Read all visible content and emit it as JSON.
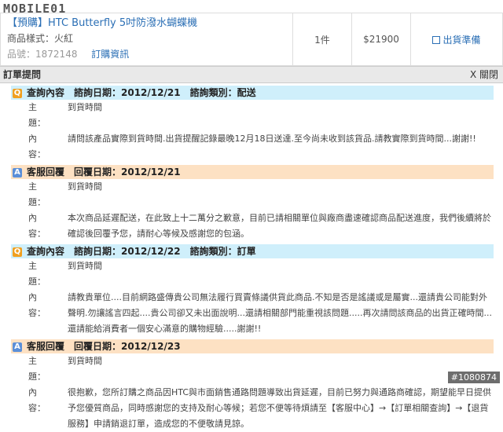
{
  "logo": "MOBILE01",
  "order": {
    "product_name": "【預購】HTC Butterfly 5吋防潑水蝴蝶機",
    "style_label": "商品樣式：",
    "style_value": "火紅",
    "sku_label": "品號：",
    "sku_value": "1872148",
    "inquiry_link": "訂購資訊",
    "quantity": "1件",
    "price": "$21900",
    "ship_status": "出貨準備"
  },
  "panel": {
    "title": "訂單提問",
    "close_label": "X 關閉"
  },
  "entries": [
    {
      "badge": "Q",
      "header": "查詢內容　諮詢日期：2012/12/21　諮詢類別：配送",
      "subject_label": "主　　題：",
      "subject": "到貨時間",
      "content_label": "內　　容：",
      "content": "請問該產品實際到貨時間.出貨提醒記錄最晚12月18日送達.至今尚未收到該貨品.請教實際到貨時間...謝謝!!"
    },
    {
      "badge": "A",
      "header": "客服回覆　回覆日期：2012/12/21",
      "subject_label": "主　　題：",
      "subject": "到貨時間",
      "content_label": "內　　容：",
      "content": "本次商品延遲配送，在此致上十二萬分之歉意，目前已請相關單位與廠商盡速確認商品配送進度，我們後續將於確認後回覆予您，請耐心等候及感謝您的包涵。"
    },
    {
      "badge": "Q",
      "header": "查詢內容　諮詢日期：2012/12/22　諮詢類別：訂單",
      "subject_label": "主　　題：",
      "subject": "到貨時間",
      "content_label": "內　　容：",
      "content": "請教貴單位....目前網路盛傳貴公司無法履行買賣條議供貨此商品.不知是否是謠議或是屬實...還請貴公司能對外聲明.勿讓謠言四起....貴公司卻又未出面說明...還請相關部門能重視該問題.....再次請問該商品的出貨正確時間...還請能給消費者一個安心滿意的購物經驗.....謝謝!!"
    },
    {
      "badge": "A",
      "header": "客服回覆　回覆日期：2012/12/23",
      "subject_label": "主　　題：",
      "subject": "到貨時間",
      "content_label": "內　　容：",
      "content": "很抱歉，您所訂購之商品因HTC與市面銷售通路問題導致出貨延遲，目前已努力與通路商確認，期望能早日提供予您優質商品，同時感謝您的支持及耐心等候；若您不便等待煩請至【客服中心】→【訂單相關查詢】→【退貨服務】申請銷退訂單，造成您的不便敬請見諒。"
    }
  ],
  "watermark": "#1080874"
}
